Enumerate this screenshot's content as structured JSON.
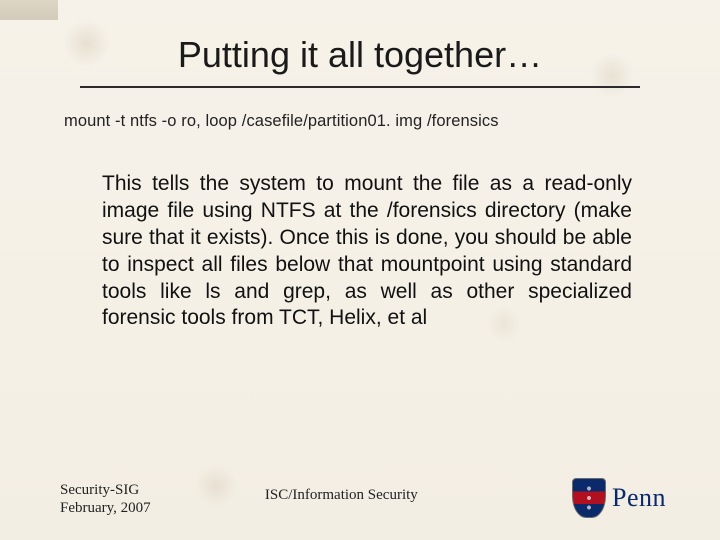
{
  "title": "Putting it all together…",
  "command": "mount -t ntfs -o ro, loop /casefile/partition01. img /forensics",
  "body": "This tells the system to mount the file as a read-only image file using NTFS at the /forensics directory (make sure that it exists). Once this is done, you should be able to inspect all files below that mountpoint using standard tools like ls and grep, as well as other specialized forensic tools from TCT, Helix, et al",
  "footer": {
    "left_line1": "Security-SIG",
    "left_line2": "February, 2007",
    "center": "ISC/Information Security",
    "logo_text": "Penn"
  }
}
